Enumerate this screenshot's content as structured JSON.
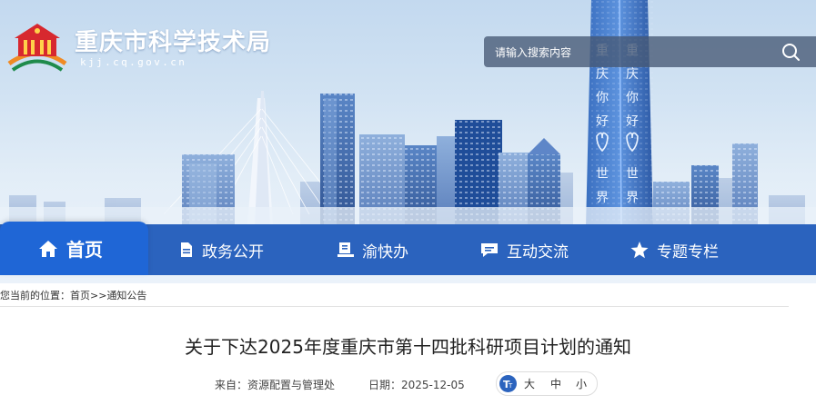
{
  "header": {
    "site_title": "重庆市科学技术局",
    "site_domain": "kjj.cq.gov.cn",
    "search": {
      "placeholder": "请输入搜索内容"
    }
  },
  "banner": {
    "tower_text_left": [
      "重",
      "庆",
      "你",
      "好",
      "世",
      "界"
    ],
    "tower_text_right": [
      "重",
      "庆",
      "你",
      "好",
      "世",
      "界"
    ]
  },
  "nav": {
    "items": [
      {
        "label": "首页",
        "icon": "home-icon",
        "active": true
      },
      {
        "label": "政务公开",
        "icon": "document-icon"
      },
      {
        "label": "渝快办",
        "icon": "stamp-icon"
      },
      {
        "label": "互动交流",
        "icon": "chat-icon"
      },
      {
        "label": "专题专栏",
        "icon": "star-icon"
      }
    ]
  },
  "breadcrumb": {
    "prefix": "您当前的位置：",
    "home": "首页",
    "sep": ">>",
    "current": "通知公告"
  },
  "article": {
    "title": "关于下达2025年度重庆市第十四批科研项目计划的通知",
    "source_label": "来自：",
    "source": "资源配置与管理处",
    "date_label": "日期：",
    "date": "2025-12-05",
    "font_sizes": [
      "大",
      "中",
      "小"
    ]
  },
  "colors": {
    "nav_bg": "#2b63be",
    "nav_active": "#1f66d6",
    "text": "#222222"
  }
}
